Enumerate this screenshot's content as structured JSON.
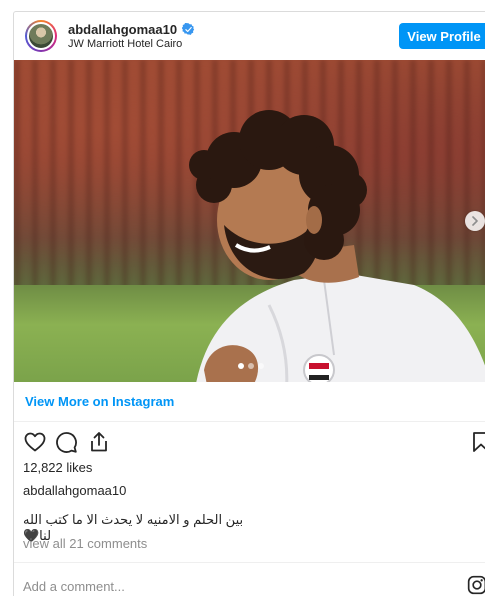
{
  "header": {
    "username": "abdallahgomaa10",
    "location": "JW Marriott Hotel Cairo",
    "view_profile_label": "View Profile"
  },
  "photo": {
    "carousel_dots": 3,
    "active_dot": 1
  },
  "view_more_label": "View More on Instagram",
  "likes_text": "12,822 likes",
  "caption": {
    "username": "abdallahgomaa10",
    "text": "بين الحلم و الامنيه لا يحدث الا ما كتب الله لنا🖤"
  },
  "view_all_comments": "view all 21 comments",
  "comment_placeholder": "Add a comment...",
  "icons": [
    "avatar",
    "verified-badge-icon",
    "next-arrow-icon",
    "heart-icon",
    "comment-icon",
    "share-icon",
    "bookmark-icon",
    "instagram-icon"
  ],
  "colors": {
    "accent": "#0095f6",
    "text": "#262626",
    "muted": "#8e8e8e",
    "border": "#dbdbdb"
  }
}
